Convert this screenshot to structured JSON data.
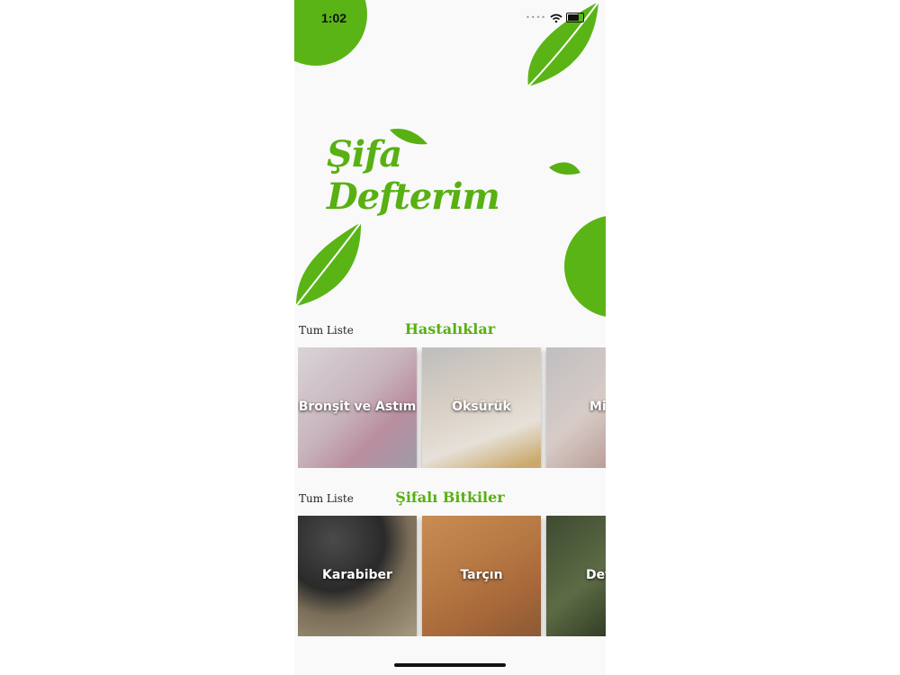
{
  "status_bar": {
    "time": "1:02"
  },
  "app": {
    "logo_text": "Şifa Defterim"
  },
  "sections": [
    {
      "title": "Hastalıklar",
      "list_link": "Tum Liste",
      "cards": [
        {
          "label": "Bronşit ve Astım"
        },
        {
          "label": "Öksürük"
        },
        {
          "label": "Mi"
        }
      ]
    },
    {
      "title": "Şifalı Bitkiler",
      "list_link": "Tum Liste",
      "cards": [
        {
          "label": "Karabiber"
        },
        {
          "label": "Tarçın"
        },
        {
          "label": "Def"
        }
      ]
    }
  ],
  "colors": {
    "brand_green": "#58b012",
    "background": "#f9f9f9"
  }
}
